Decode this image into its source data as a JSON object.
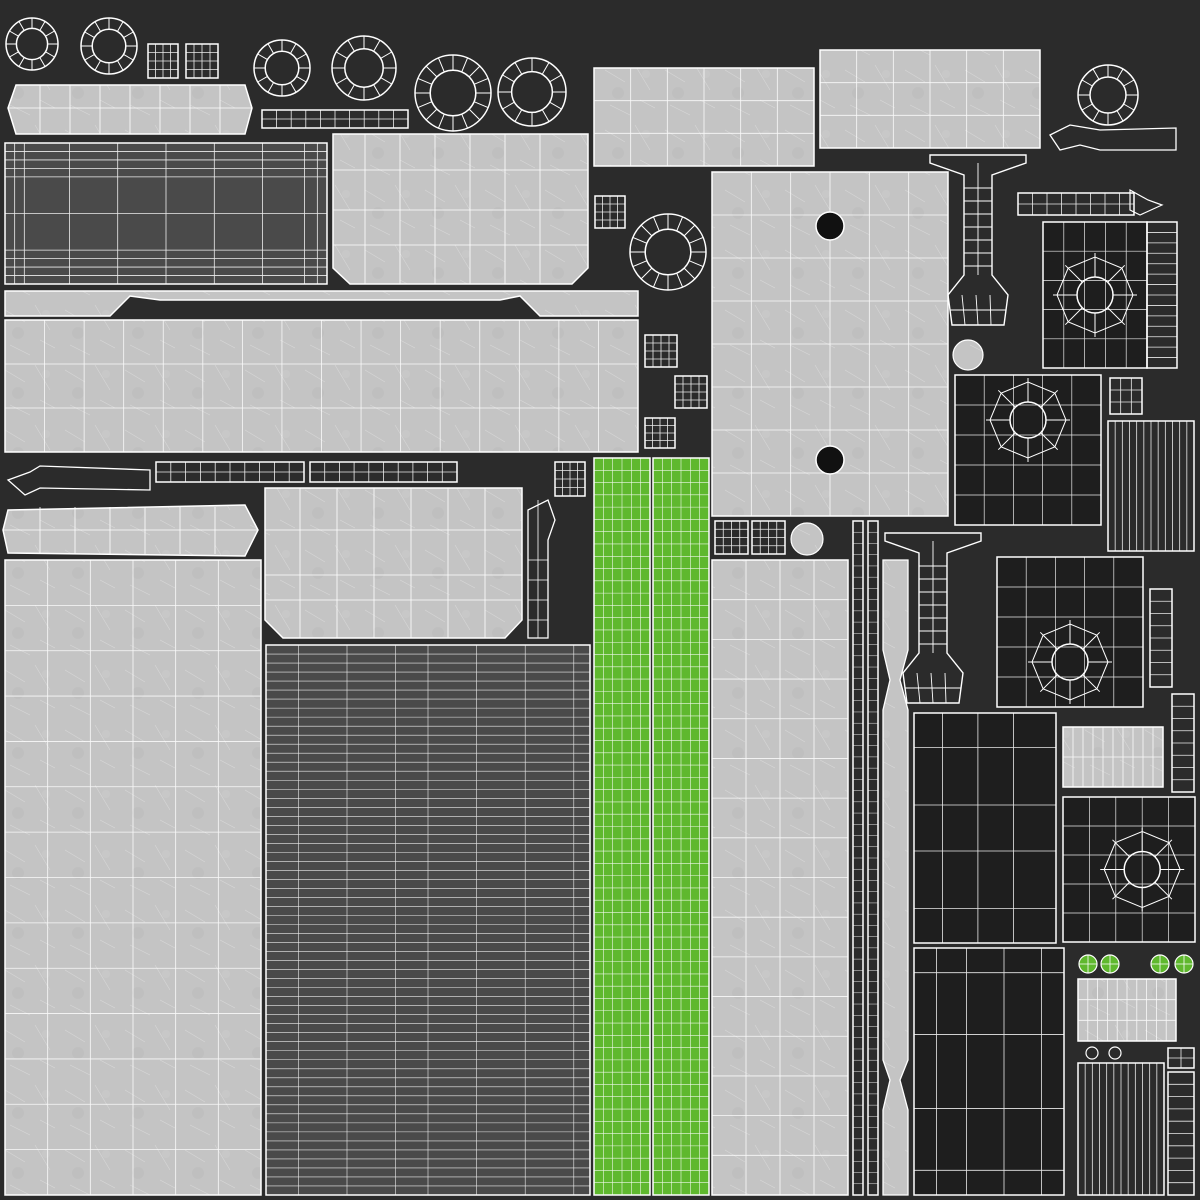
{
  "texture": {
    "background_color": "#2b2b2b",
    "wire_color": "#ffffff",
    "palette": {
      "concrete": "#c4c4c4",
      "dark_panel": "#4a4a4a",
      "black_panel": "#1e1e1e",
      "green": "#5fb82e"
    },
    "icons": {
      "ring": "ring-icon",
      "hole": "hole-icon",
      "small_green_disc": "green-disc-icon"
    }
  }
}
